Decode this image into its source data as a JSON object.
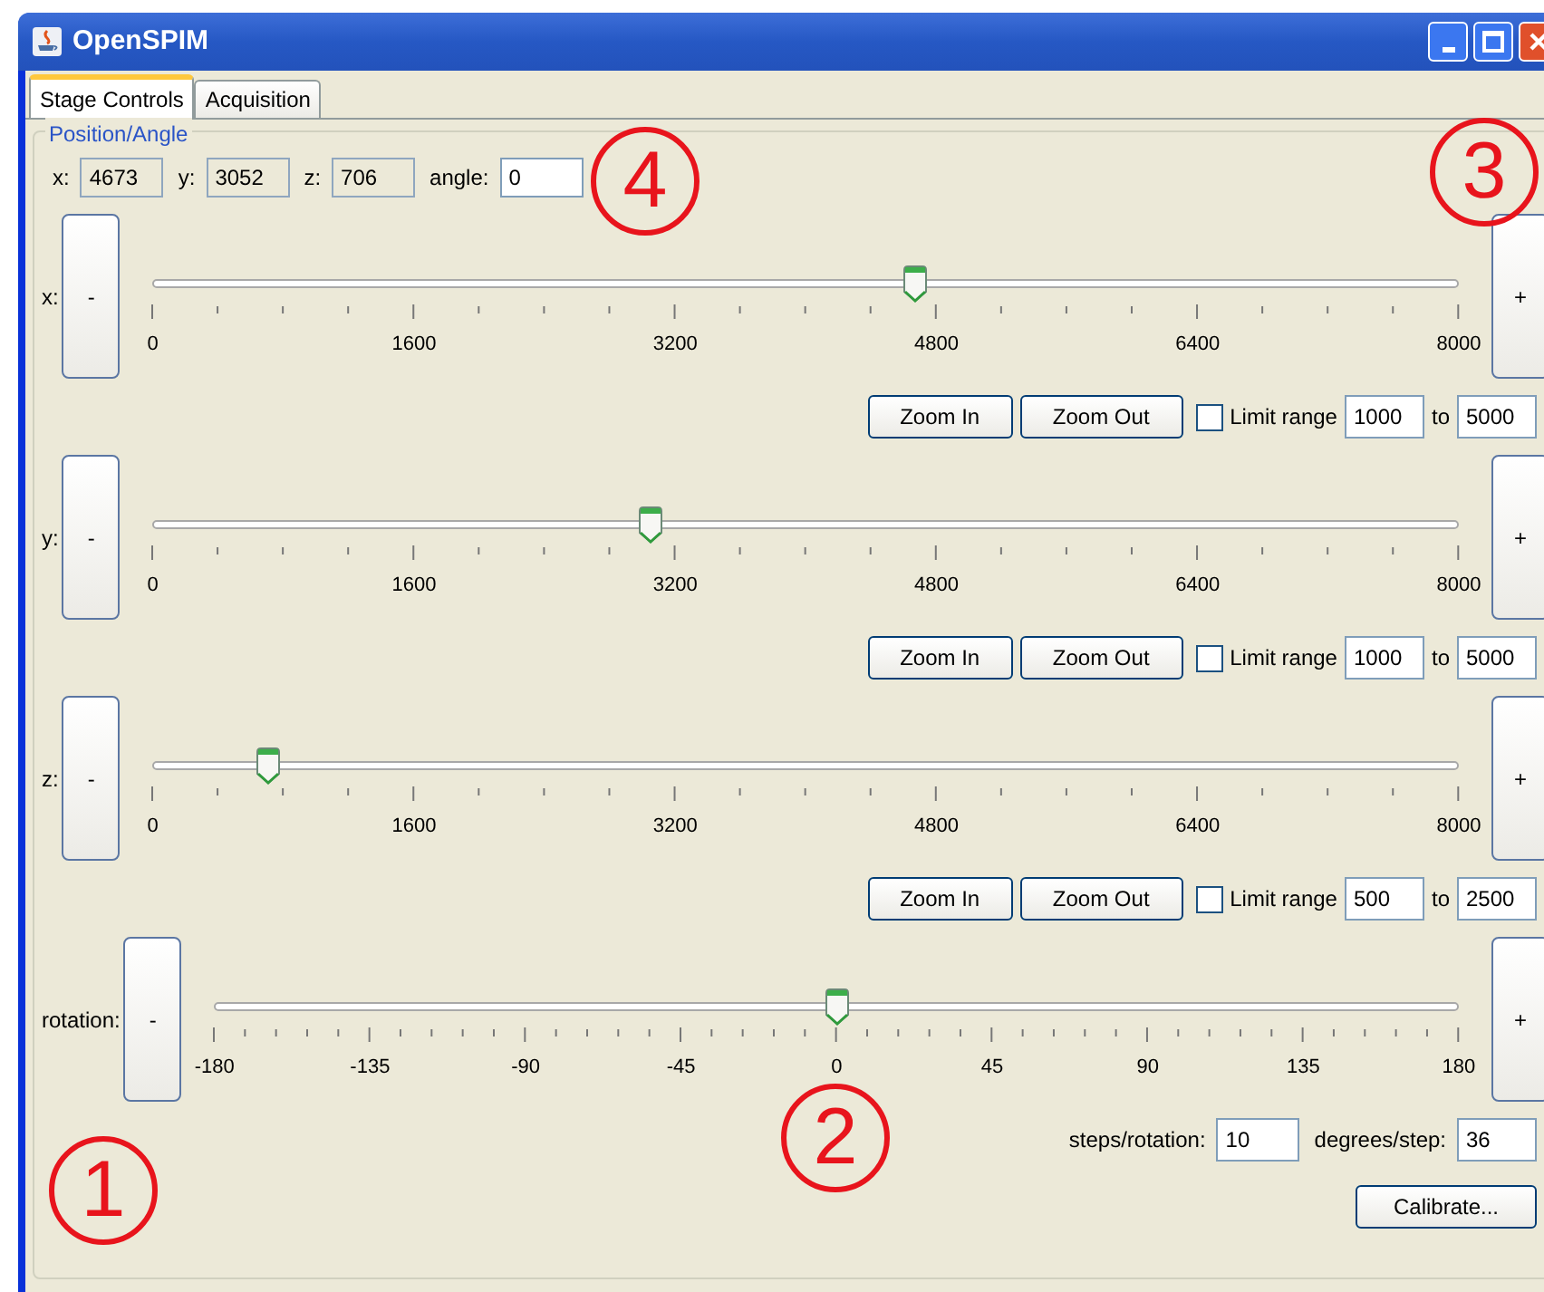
{
  "window": {
    "title": "OpenSPIM"
  },
  "tabs": [
    {
      "label": "Stage Controls",
      "selected": true
    },
    {
      "label": "Acquisition",
      "selected": false
    }
  ],
  "group": {
    "title": "Position/Angle"
  },
  "position_fields": [
    {
      "label": "x:",
      "value": "4673",
      "editable": false
    },
    {
      "label": "y:",
      "value": "3052",
      "editable": false
    },
    {
      "label": "z:",
      "value": "706",
      "editable": false
    },
    {
      "label": "angle:",
      "value": "0",
      "editable": true
    }
  ],
  "sliders": [
    {
      "kind": "position",
      "label": "x:",
      "minus": "-",
      "plus": "+",
      "level": 0.584,
      "tick_labels": [
        "0",
        "1600",
        "3200",
        "4800",
        "6400",
        "8000"
      ],
      "controls": {
        "zoom_in": "Zoom In",
        "zoom_out": "Zoom Out",
        "limit_label": "Limit range",
        "checked": false,
        "from": "1000",
        "to_label": "to",
        "to": "5000"
      }
    },
    {
      "kind": "position",
      "label": "y:",
      "minus": "-",
      "plus": "+",
      "level": 0.3815,
      "tick_labels": [
        "0",
        "1600",
        "3200",
        "4800",
        "6400",
        "8000"
      ],
      "controls": {
        "zoom_in": "Zoom In",
        "zoom_out": "Zoom Out",
        "limit_label": "Limit range",
        "checked": false,
        "from": "1000",
        "to_label": "to",
        "to": "5000"
      }
    },
    {
      "kind": "position",
      "label": "z:",
      "minus": "-",
      "plus": "+",
      "level": 0.088,
      "tick_labels": [
        "0",
        "1600",
        "3200",
        "4800",
        "6400",
        "8000"
      ],
      "controls": {
        "zoom_in": "Zoom In",
        "zoom_out": "Zoom Out",
        "limit_label": "Limit range",
        "checked": false,
        "from": "500",
        "to_label": "to",
        "to": "2500"
      }
    },
    {
      "kind": "rotation",
      "label": "rotation:",
      "minus": "-",
      "plus": "+",
      "level": 0.5,
      "tick_labels": [
        "-180",
        "-135",
        "-90",
        "-45",
        "0",
        "45",
        "90",
        "135",
        "180"
      ]
    }
  ],
  "rotation_settings": {
    "steps_label": "steps/rotation:",
    "steps": "10",
    "degrees_label": "degrees/step:",
    "degrees": "36",
    "calibrate": "Calibrate..."
  },
  "callouts": [
    {
      "label": "4"
    },
    {
      "label": "3"
    },
    {
      "label": "2"
    },
    {
      "label": "1"
    }
  ]
}
